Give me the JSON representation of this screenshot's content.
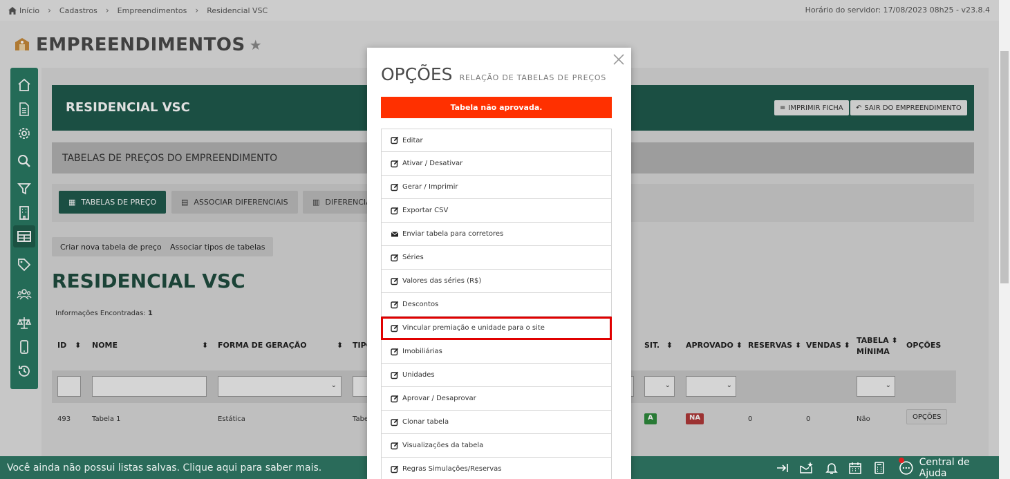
{
  "breadcrumb": [
    "Início",
    "Cadastros",
    "Empreendimentos",
    "Residencial VSC"
  ],
  "server_time": "Horário do servidor: 17/08/2023 08h25 - v23.8.4",
  "page_title": "EMPREENDIMENTOS",
  "banner": {
    "title": "RESIDENCIAL VSC",
    "print_label": "IMPRIMIR FICHA",
    "exit_label": "SAIR DO EMPREENDIMENTO"
  },
  "section_title": "TABELAS DE PREÇOS DO EMPREENDIMENTO",
  "tabs": [
    "TABELAS DE PREÇO",
    "ASSOCIAR DIFERENCIAIS",
    "DIFERENCIAIS"
  ],
  "actions": [
    "Criar nova tabela de preço",
    "Associar tipos de tabelas"
  ],
  "big_title": "RESIDENCIAL VSC",
  "info": {
    "label": "Informações Encontradas:",
    "count": "1"
  },
  "table": {
    "headers": {
      "id": "ID",
      "nome": "NOME",
      "forma": "FORMA DE GERAÇÃO",
      "tipo": "TIPO",
      "sit": "SIT.",
      "aprovado": "APROVADO",
      "reservas": "RESERVAS",
      "vendas": "VENDAS",
      "minima_1": "TABELA",
      "minima_2": "MÍNIMA",
      "opcoes": "OPÇÕES"
    },
    "row": {
      "id": "493",
      "nome": "Tabela 1",
      "forma": "Estática",
      "tipo": "Tabe",
      "sit": "A",
      "aprovado": "NA",
      "reservas": "0",
      "vendas": "0",
      "minima": "Não",
      "opcoes": "OPÇÕES"
    }
  },
  "bottom": {
    "message": "Você ainda não possui listas salvas. Clique aqui para saber mais.",
    "help": "Central de Ajuda"
  },
  "modal": {
    "title": "OPÇÕES",
    "subtitle": "RELAÇÃO DE TABELAS DE PREÇOS",
    "alert": "Tabela não aprovada.",
    "options": [
      "Editar",
      "Ativar / Desativar",
      "Gerar / Imprimir",
      "Exportar CSV",
      "Enviar tabela para corretores",
      "Séries",
      "Valores das séries (R$)",
      "Descontos",
      "Vincular premiação e unidade para o site",
      "Imobiliárias",
      "Unidades",
      "Aprovar / Desaprovar",
      "Clonar tabela",
      "Visualizações da tabela",
      "Regras Simulações/Reservas"
    ]
  },
  "colors": {
    "primary": "#1f5a4d",
    "sidebar": "#2a7a63",
    "alert": "#ff3000",
    "highlight": "#e00000"
  }
}
